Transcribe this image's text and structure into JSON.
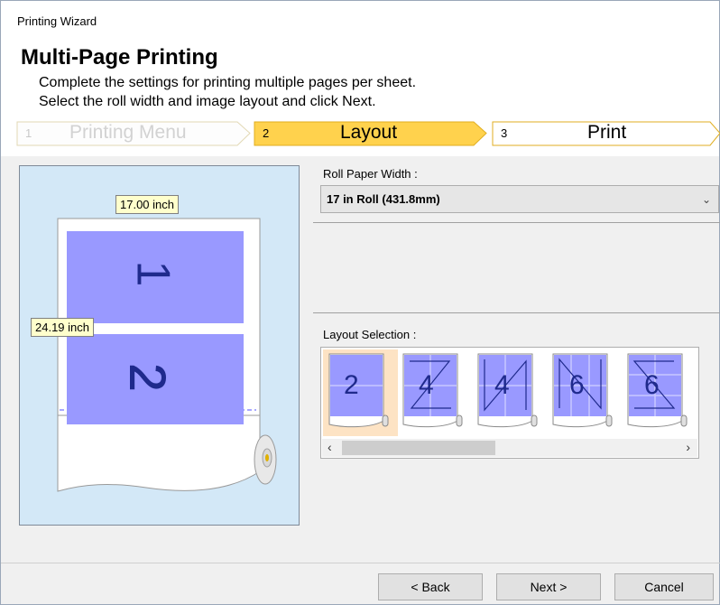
{
  "window": {
    "title": "Printing Wizard"
  },
  "header": {
    "title": "Multi-Page Printing",
    "desc_line1": "Complete the settings for printing multiple pages per sheet.",
    "desc_line2": "Select the roll width and image layout and click Next."
  },
  "steps": [
    {
      "num": "1",
      "label": "Printing Menu",
      "state": "done"
    },
    {
      "num": "2",
      "label": "Layout",
      "state": "active"
    },
    {
      "num": "3",
      "label": "Print",
      "state": "upcoming"
    }
  ],
  "preview": {
    "width_label": "17.00 inch",
    "height_label": "24.19 inch",
    "page1": "1",
    "page2": "2"
  },
  "roll_paper": {
    "label": "Roll Paper Width :",
    "value": "17 in Roll (431.8mm)"
  },
  "layout_selection": {
    "label": "Layout Selection :",
    "options": [
      "2",
      "4",
      "4",
      "6",
      "6"
    ],
    "selected_index": 0
  },
  "buttons": {
    "back": "< Back",
    "next": "Next >",
    "cancel": "Cancel"
  },
  "colors": {
    "accent": "#ffd24d",
    "page": "#9999ff",
    "preview_bg": "#d3e8f7"
  },
  "icons": {
    "dropdown": "chevron-down-icon",
    "scroll_left": "chevron-left-icon",
    "scroll_right": "chevron-right-icon"
  }
}
